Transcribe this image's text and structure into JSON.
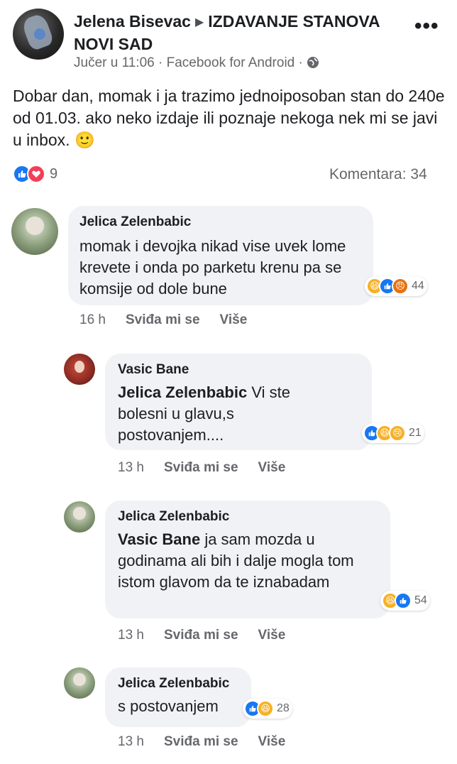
{
  "post": {
    "author": "Jelena Bisevac",
    "group": "IZDAVANJE STANOVA NOVI SAD",
    "time": "Jučer u 11:06",
    "source": "Facebook for Android",
    "separator": "·",
    "text": "Dobar dan, momak i ja trazimo jednoiposoban stan do 240e od 01.03. ako neko izdaje ili poznaje nekoga nek mi se javi u inbox. 🙂",
    "reaction_count": "9",
    "comments_label": "Komentara: 34",
    "more_icon": "more-dots-icon",
    "privacy_icon": "globe-icon"
  },
  "comments": [
    {
      "name": "Jelica Zelenbabic",
      "mention": "",
      "text": "momak i devojka nikad vise uvek lome krevete i onda po parketu krenu pa se komsije od dole bune",
      "reactions": [
        "haha",
        "like",
        "angry"
      ],
      "reaction_count": "44",
      "time": "16 h",
      "like_label": "Sviđa mi se",
      "more_label": "Više"
    },
    {
      "name": "Vasic Bane",
      "mention": "Jelica Zelenbabic",
      "text": "Vi ste bolesni u glavu,s postovanjem....",
      "reactions": [
        "like",
        "haha",
        "sad"
      ],
      "reaction_count": "21",
      "time": "13 h",
      "like_label": "Sviđa mi se",
      "more_label": "Više"
    },
    {
      "name": "Jelica Zelenbabic",
      "mention": "Vasic Bane",
      "text": "ja sam mozda u godinama ali bih i dalje mogla tom istom glavom da te iznabadam",
      "reactions": [
        "haha",
        "like"
      ],
      "reaction_count": "54",
      "time": "13 h",
      "like_label": "Sviđa mi se",
      "more_label": "Više"
    },
    {
      "name": "Jelica Zelenbabic",
      "mention": "",
      "text": "s postovanjem",
      "reactions": [
        "like",
        "haha"
      ],
      "reaction_count": "28",
      "time": "13 h",
      "like_label": "Sviđa mi se",
      "more_label": "Više"
    }
  ],
  "colors": {
    "like": "#1877f2",
    "love": "#f33e58",
    "haha": "#f7b125",
    "angry": "#e9710f",
    "bubble": "#f0f2f5",
    "secondary_text": "#65676b"
  }
}
